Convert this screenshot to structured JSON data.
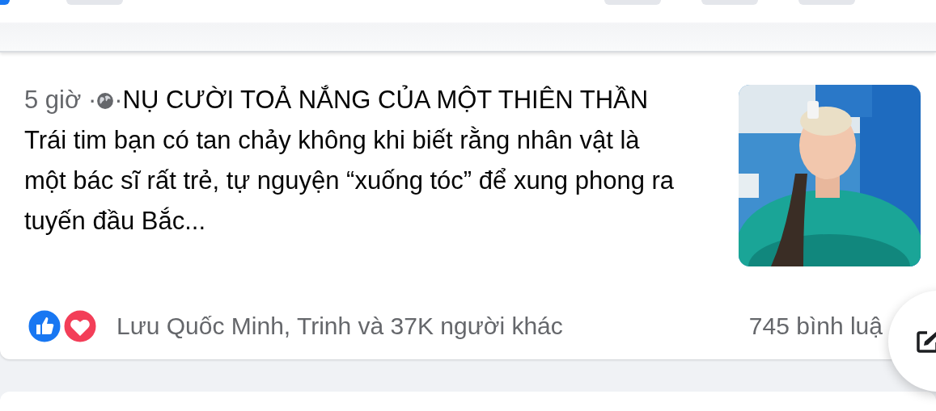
{
  "post": {
    "time": "5 giờ",
    "separator": "·",
    "text": "NỤ CƯỜI TOẢ NẮNG CỦA MỘT THIÊN THẦN Trái tim bạn có tan chảy không khi biết rằng nhân vật là một bác sĩ rất trẻ, tự nguyện “xuống tóc” để xung phong ra tuyến đầu Bắc...",
    "reactions": "Lưu Quốc Minh, Trinh và 37K người khác",
    "comments": "745 bình luậ"
  }
}
